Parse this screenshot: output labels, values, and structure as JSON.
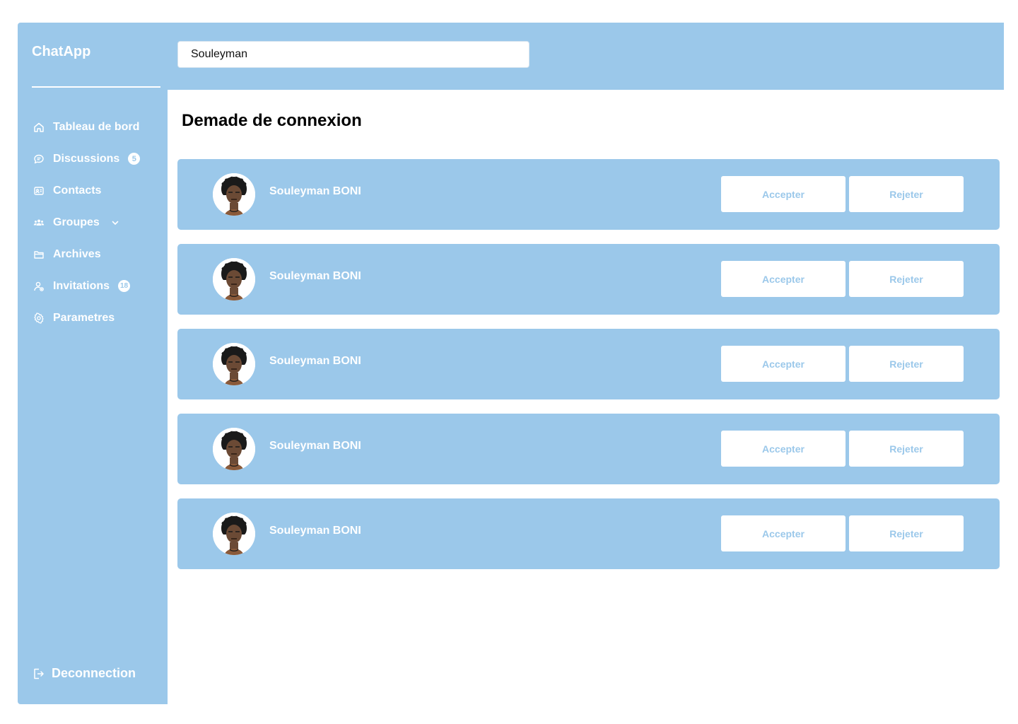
{
  "app": {
    "title": "ChatApp"
  },
  "sidebar": {
    "items": [
      {
        "label": "Tableau de bord",
        "icon": "home-icon"
      },
      {
        "label": "Discussions",
        "icon": "chat-icon",
        "badge": "5"
      },
      {
        "label": "Contacts",
        "icon": "contacts-icon"
      },
      {
        "label": "Groupes",
        "icon": "groups-icon"
      },
      {
        "label": "Archives",
        "icon": "folder-icon"
      },
      {
        "label": "Invitations",
        "icon": "user-invite-icon",
        "badge": "18"
      },
      {
        "label": "Parametres",
        "icon": "gear-icon"
      }
    ],
    "logout_label": "Deconnection"
  },
  "search": {
    "value": "Souleyman"
  },
  "main": {
    "title": "Demade de connexion",
    "requests": [
      {
        "name": "Souleyman BONI",
        "accept_label": "Accepter",
        "reject_label": "Rejeter"
      },
      {
        "name": "Souleyman BONI",
        "accept_label": "Accepter",
        "reject_label": "Rejeter"
      },
      {
        "name": "Souleyman BONI",
        "accept_label": "Accepter",
        "reject_label": "Rejeter"
      },
      {
        "name": "Souleyman BONI",
        "accept_label": "Accepter",
        "reject_label": "Rejeter"
      },
      {
        "name": "Souleyman BONI",
        "accept_label": "Accepter",
        "reject_label": "Rejeter"
      }
    ]
  },
  "colors": {
    "accent": "#9bc8ea",
    "white": "#ffffff"
  }
}
